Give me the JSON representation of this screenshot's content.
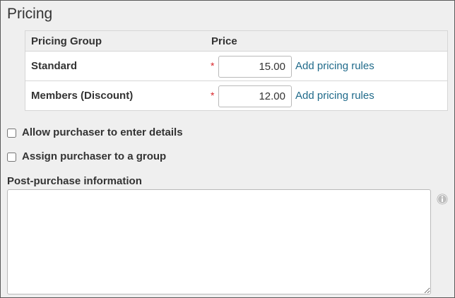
{
  "section": {
    "title": "Pricing"
  },
  "pricing_table": {
    "headers": {
      "group": "Pricing Group",
      "price": "Price"
    },
    "required_marker": "*",
    "rows": [
      {
        "name": "Standard",
        "price": "15.00",
        "link": "Add pricing rules"
      },
      {
        "name": "Members (Discount)",
        "price": "12.00",
        "link": "Add pricing rules"
      }
    ]
  },
  "options": {
    "allow_details": {
      "label": "Allow purchaser to enter details",
      "checked": false
    },
    "assign_group": {
      "label": "Assign purchaser to a group",
      "checked": false
    }
  },
  "post_purchase": {
    "label": "Post-purchase information",
    "value": ""
  },
  "icons": {
    "info": "info-icon"
  },
  "colors": {
    "link": "#1f6a8a",
    "required": "#d9262b",
    "panel_bg": "#efefef"
  }
}
